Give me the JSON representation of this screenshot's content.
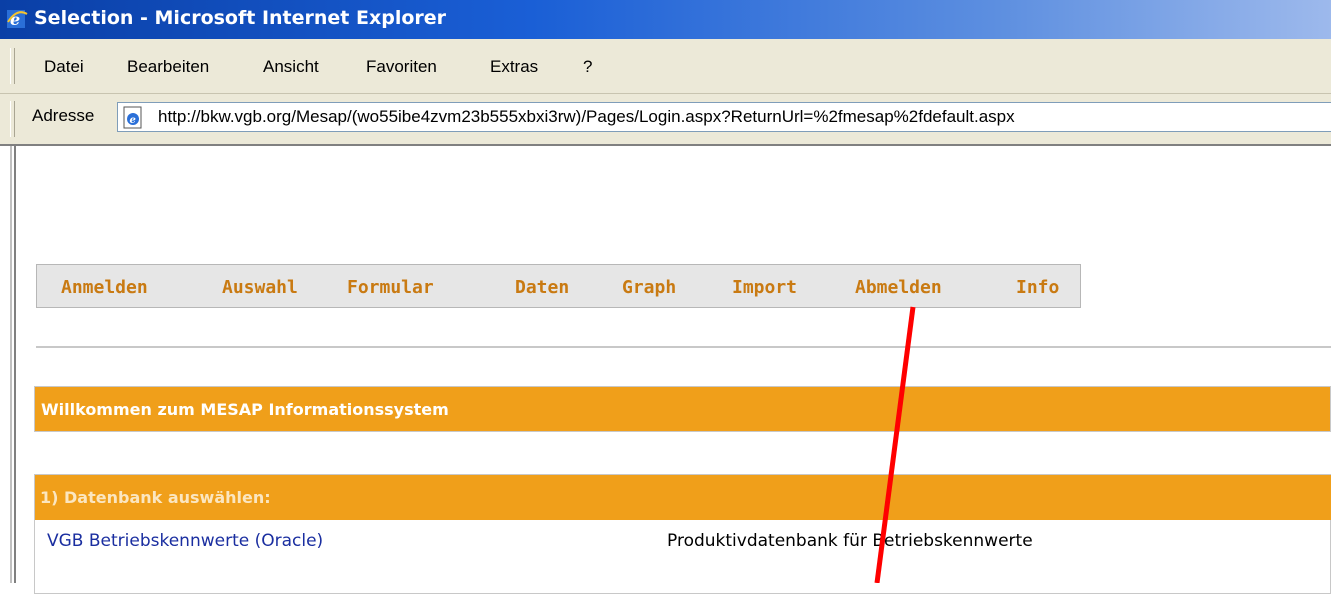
{
  "window": {
    "title": "Selection - Microsoft Internet Explorer",
    "icon": "ie-icon"
  },
  "menubar": {
    "items": [
      "Datei",
      "Bearbeiten",
      "Ansicht",
      "Favoriten",
      "Extras",
      "?"
    ]
  },
  "addressbar": {
    "label": "Adresse",
    "url": "http://bkw.vgb.org/Mesap/(wo55ibe4zvm23b555xbxi3rw)/Pages/Login.aspx?ReturnUrl=%2fmesap%2fdefault.aspx",
    "icon": "page-icon"
  },
  "nav": {
    "items": [
      "Anmelden",
      "Auswahl",
      "Formular",
      "Daten",
      "Graph",
      "Import",
      "Abmelden",
      "Info"
    ]
  },
  "welcome": {
    "text": "Willkommen zum MESAP Informationssystem"
  },
  "database": {
    "header": "1) Datenbank auswählen:",
    "rows": [
      {
        "name": "VGB Betriebskennwerte (Oracle)",
        "description": "Produktivdatenbank für Betriebskennwerte"
      }
    ]
  },
  "colors": {
    "accent": "#f09f1a",
    "nav_link": "#c97a12",
    "link": "#1a2ea0",
    "annotation": "#ff0000"
  }
}
